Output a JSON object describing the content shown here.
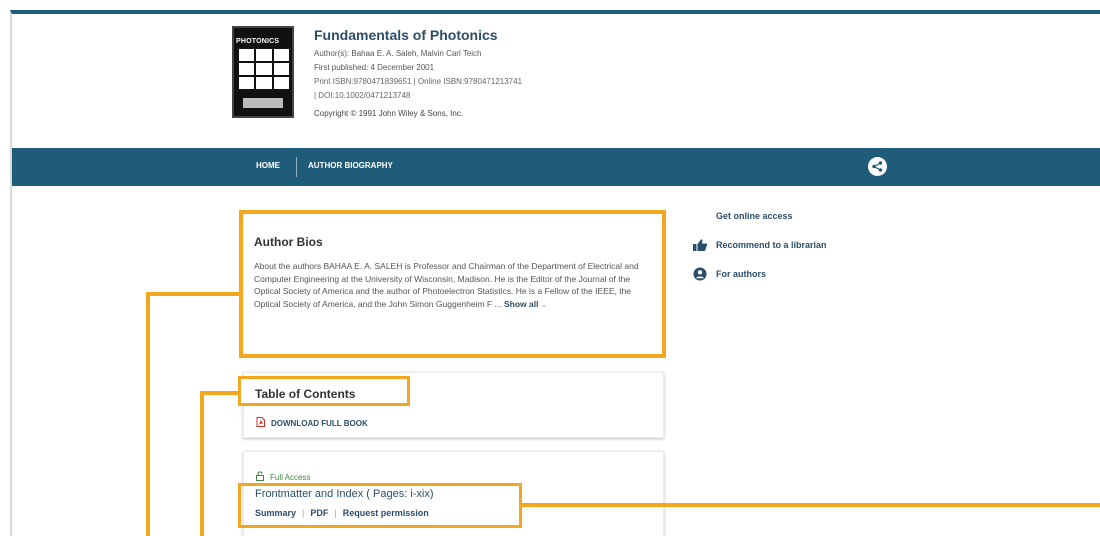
{
  "book": {
    "cover_brand": "PHOTONICS",
    "title": "Fundamentals of Photonics",
    "authors_label": "Author(s):",
    "authors": "Bahaa E. A. Saleh, Malvin Carl Teich",
    "published_label": "First published:",
    "published": "4 December 2001",
    "isbn_line": "Print ISBN:9780471839651 | Online ISBN:9780471213741",
    "doi_line": "| DOI:10.1002/0471213748",
    "copyright": "Copyright © 1991 John Wiley & Sons, Inc."
  },
  "nav": {
    "home": "HOME",
    "author_biography": "AUTHOR BIOGRAPHY"
  },
  "sidebar": {
    "online_access": "Get online access",
    "recommend": "Recommend to a librarian",
    "for_authors": "For authors"
  },
  "bios": {
    "title": "Author Bios",
    "text": "About the authors BAHAA E. A. SALEH is Professor and Chairman of the Department of Electrical and Computer Engineering at the University of Wisconsin, Madison. He is the Editor of the Journal of the Optical Society of America and the author of Photoelectron Statistics. He is a Fellow of the IEEE, the Optical Society of America, and the John Simon Guggenheim F ...",
    "show_all": "Show all",
    "chevron": "⌄"
  },
  "toc": {
    "title": "Table of Contents",
    "download": "DOWNLOAD FULL BOOK"
  },
  "chapter": {
    "access": "Full Access",
    "title": "Frontmatter and Index ( Pages: i-xix)",
    "links": [
      "Summary",
      "PDF",
      "Request permission"
    ]
  },
  "colors": {
    "navbar": "#1f5c7a",
    "highlight": "#f3a71f",
    "link": "#2c4e6b"
  }
}
